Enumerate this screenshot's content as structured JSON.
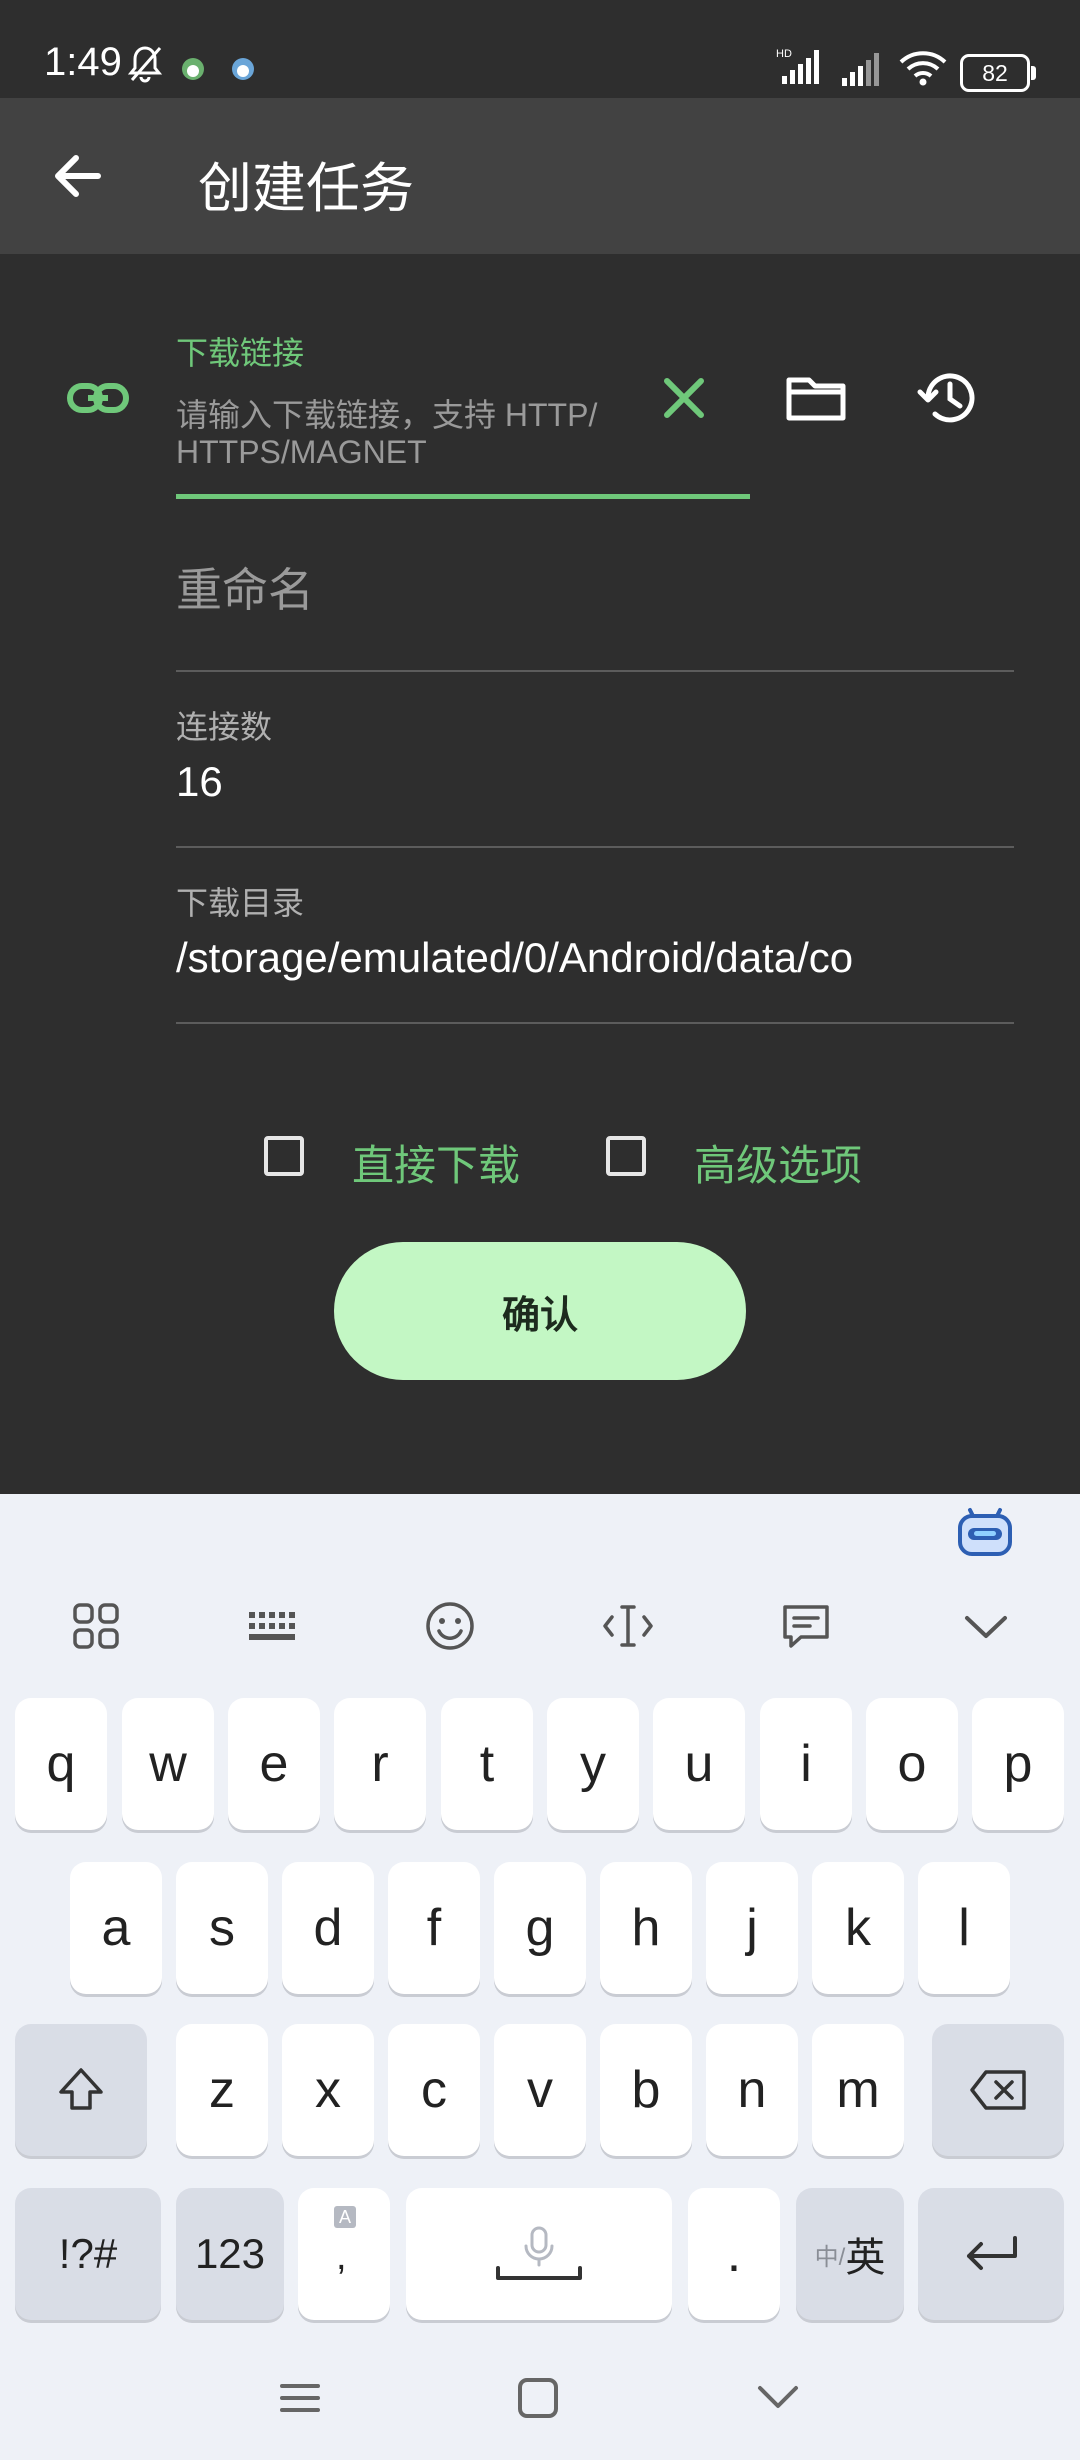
{
  "status_bar": {
    "time": "1:49",
    "battery": "82",
    "network_badge": "HD"
  },
  "app_bar": {
    "title": "创建任务"
  },
  "form": {
    "download_link": {
      "label": "下载链接",
      "placeholder_line1": "请输入下载链接，支持 HTTP/",
      "placeholder_line2": "HTTPS/MAGNET"
    },
    "rename": {
      "placeholder": "重命名"
    },
    "connections": {
      "label": "连接数",
      "value": "16"
    },
    "download_dir": {
      "label": "下载目录",
      "value": "/storage/emulated/0/Android/data/co"
    },
    "direct_download": {
      "label": "直接下载",
      "checked": false
    },
    "advanced_options": {
      "label": "高级选项",
      "checked": false
    },
    "confirm_label": "确认"
  },
  "keyboard": {
    "row1": [
      "q",
      "w",
      "e",
      "r",
      "t",
      "y",
      "u",
      "i",
      "o",
      "p"
    ],
    "row2": [
      "a",
      "s",
      "d",
      "f",
      "g",
      "h",
      "j",
      "k",
      "l"
    ],
    "row3": [
      "z",
      "x",
      "c",
      "v",
      "b",
      "n",
      "m"
    ],
    "symbols_key": "!?#",
    "numbers_key": "123",
    "comma_key": ",",
    "comma_hint": "A",
    "period_key": ".",
    "lang_key_small": "中/",
    "lang_key_main": "英"
  },
  "colors": {
    "accent_green": "#6fc87a",
    "app_bar": "#424242",
    "background": "#2e2e2e",
    "confirm_button": "#c3f7c4"
  }
}
